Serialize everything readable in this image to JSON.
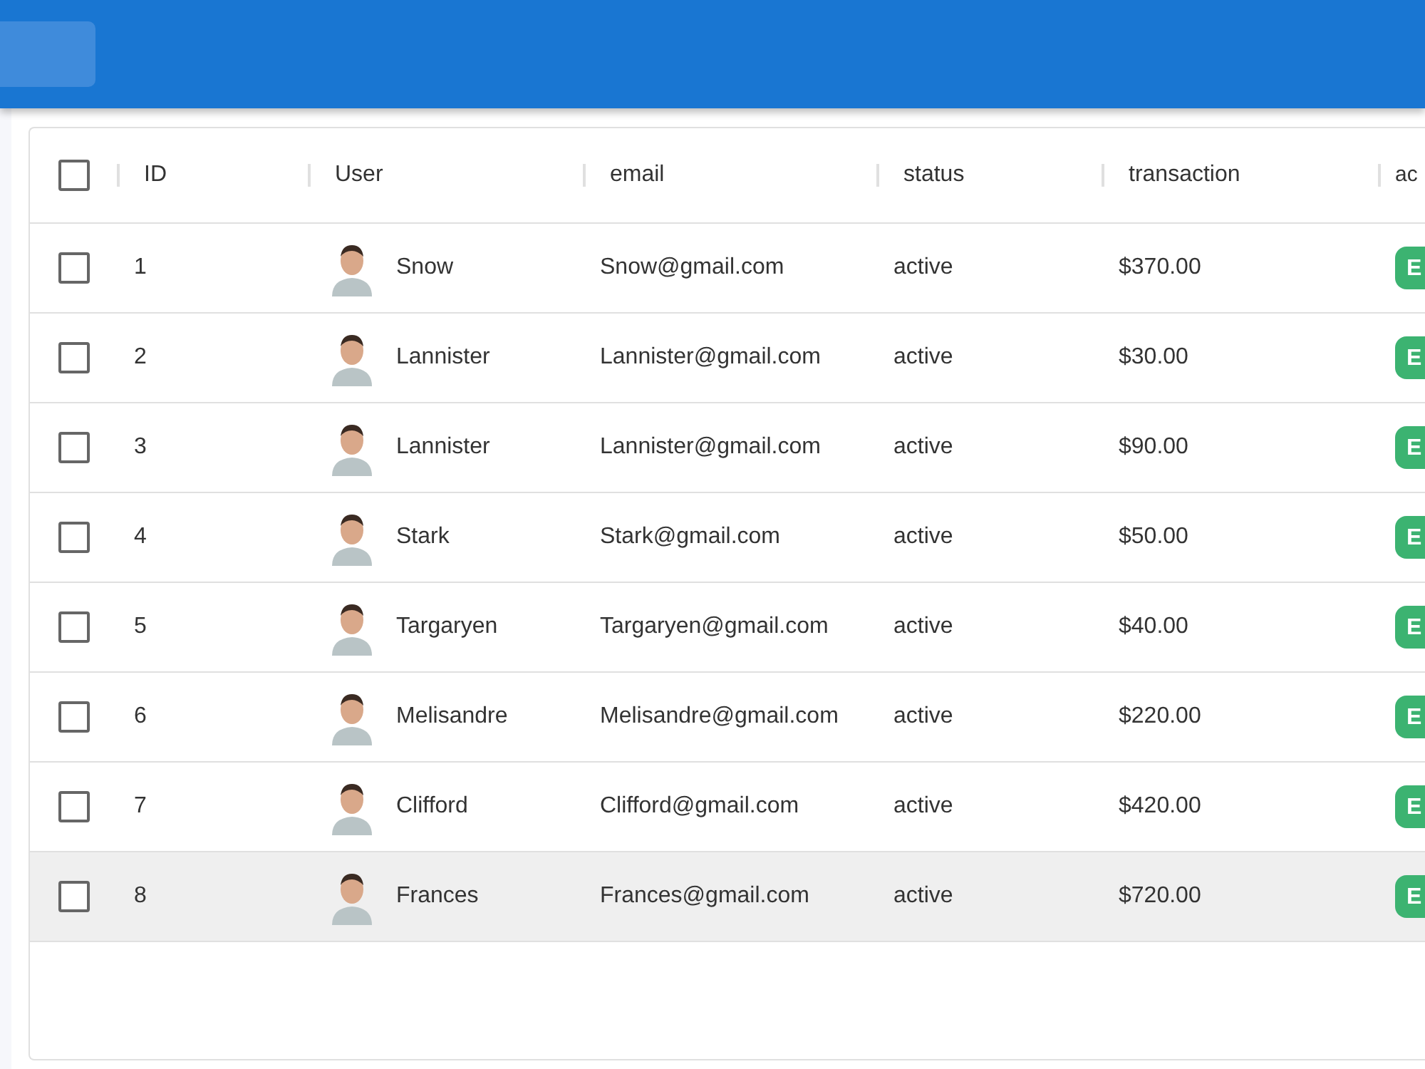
{
  "table": {
    "select_all": {
      "checked": false
    },
    "columns": [
      {
        "label": "ID"
      },
      {
        "label": "User"
      },
      {
        "label": "email"
      },
      {
        "label": "status"
      },
      {
        "label": "transaction"
      },
      {
        "label": "ac"
      }
    ],
    "rows": [
      {
        "checked": false,
        "highlighted": false,
        "id": "1",
        "user": "Snow",
        "email": "Snow@gmail.com",
        "status": "active",
        "transaction": "$370.00",
        "action": "E"
      },
      {
        "checked": false,
        "highlighted": false,
        "id": "2",
        "user": "Lannister",
        "email": "Lannister@gmail.com",
        "status": "active",
        "transaction": "$30.00",
        "action": "E"
      },
      {
        "checked": false,
        "highlighted": false,
        "id": "3",
        "user": "Lannister",
        "email": "Lannister@gmail.com",
        "status": "active",
        "transaction": "$90.00",
        "action": "E"
      },
      {
        "checked": false,
        "highlighted": false,
        "id": "4",
        "user": "Stark",
        "email": "Stark@gmail.com",
        "status": "active",
        "transaction": "$50.00",
        "action": "E"
      },
      {
        "checked": false,
        "highlighted": false,
        "id": "5",
        "user": "Targaryen",
        "email": "Targaryen@gmail.com",
        "status": "active",
        "transaction": "$40.00",
        "action": "E"
      },
      {
        "checked": false,
        "highlighted": false,
        "id": "6",
        "user": "Melisandre",
        "email": "Melisandre@gmail.com",
        "status": "active",
        "transaction": "$220.00",
        "action": "E"
      },
      {
        "checked": false,
        "highlighted": false,
        "id": "7",
        "user": "Clifford",
        "email": "Clifford@gmail.com",
        "status": "active",
        "transaction": "$420.00",
        "action": "E"
      },
      {
        "checked": false,
        "highlighted": true,
        "id": "8",
        "user": "Frances",
        "email": "Frances@gmail.com",
        "status": "active",
        "transaction": "$720.00",
        "action": "E"
      }
    ]
  }
}
